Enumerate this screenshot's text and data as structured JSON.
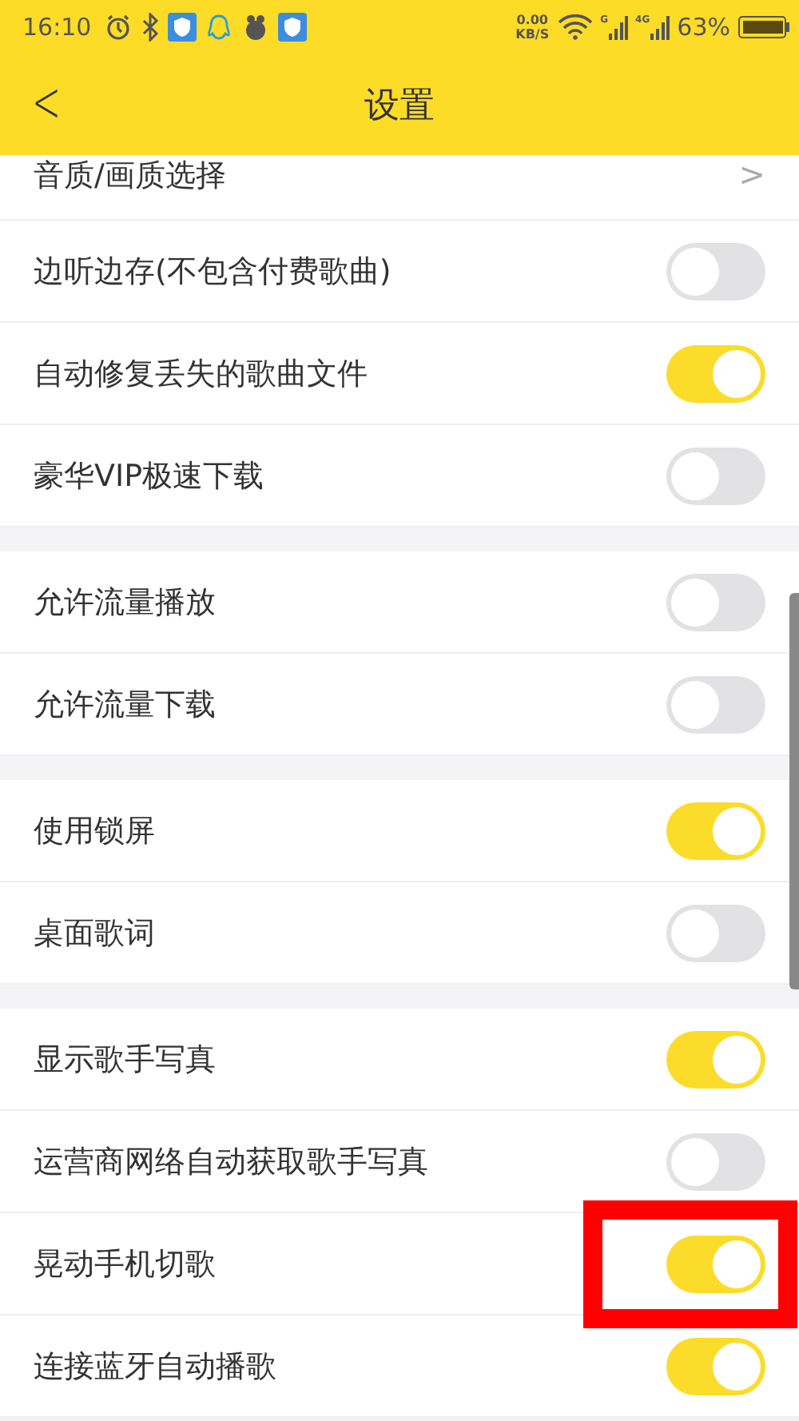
{
  "status_bar": {
    "time": "16:10",
    "net_speed": "0.00",
    "net_unit": "KB/S",
    "signal_1": "G",
    "signal_2": "4G",
    "battery": "63%"
  },
  "header": {
    "back": "<",
    "title": "设置"
  },
  "groups": [
    {
      "items": [
        {
          "kind": "link",
          "label": "音质/画质选择",
          "arrow": ">"
        },
        {
          "kind": "toggle",
          "label": "边听边存(不包含付费歌曲)",
          "on": false
        },
        {
          "kind": "toggle",
          "label": "自动修复丢失的歌曲文件",
          "on": true
        },
        {
          "kind": "toggle",
          "label": "豪华VIP极速下载",
          "on": false
        }
      ]
    },
    {
      "items": [
        {
          "kind": "toggle",
          "label": "允许流量播放",
          "on": false
        },
        {
          "kind": "toggle",
          "label": "允许流量下载",
          "on": false
        }
      ]
    },
    {
      "items": [
        {
          "kind": "toggle",
          "label": "使用锁屏",
          "on": true
        },
        {
          "kind": "toggle",
          "label": "桌面歌词",
          "on": false
        }
      ]
    },
    {
      "items": [
        {
          "kind": "toggle",
          "label": "显示歌手写真",
          "on": true
        },
        {
          "kind": "toggle",
          "label": "运营商网络自动获取歌手写真",
          "on": false
        },
        {
          "kind": "toggle",
          "label": "晃动手机切歌",
          "on": true,
          "highlighted": true
        },
        {
          "kind": "toggle",
          "label": "连接蓝牙自动播歌",
          "on": true
        }
      ]
    }
  ]
}
